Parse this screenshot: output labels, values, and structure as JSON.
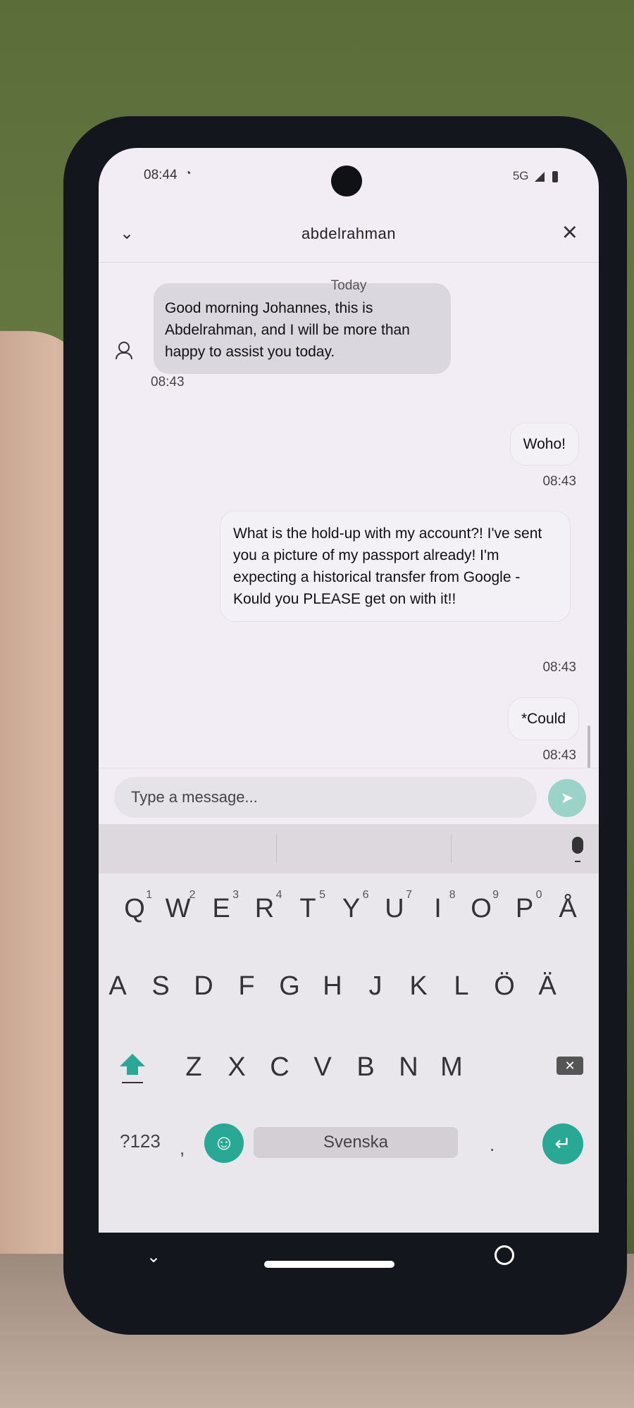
{
  "status_bar": {
    "time": "08:44",
    "network": "5G"
  },
  "header": {
    "title": "abdelrahman"
  },
  "chat": {
    "date_label": "Today",
    "messages": [
      {
        "direction": "in",
        "text": "Good morning Johannes, this is Abdelrahman, and I will be more than happy to assist you today.",
        "time": "08:43"
      },
      {
        "direction": "out",
        "text": "Woho!",
        "time": "08:43"
      },
      {
        "direction": "out",
        "text": "What is the hold-up with my account?! I've sent you a picture of my passport already! I'm expecting a historical transfer from Google - Kould you PLEASE get on with it!!",
        "time": "08:43"
      },
      {
        "direction": "out",
        "text": "*Could",
        "time": "08:43"
      }
    ]
  },
  "composer": {
    "placeholder": "Type a message..."
  },
  "keyboard": {
    "row1": [
      {
        "k": "Q",
        "h": "1"
      },
      {
        "k": "W",
        "h": "2"
      },
      {
        "k": "E",
        "h": "3"
      },
      {
        "k": "R",
        "h": "4"
      },
      {
        "k": "T",
        "h": "5"
      },
      {
        "k": "Y",
        "h": "6"
      },
      {
        "k": "U",
        "h": "7"
      },
      {
        "k": "I",
        "h": "8"
      },
      {
        "k": "O",
        "h": "9"
      },
      {
        "k": "P",
        "h": "0"
      },
      {
        "k": "Å",
        "h": ""
      }
    ],
    "row2": [
      "A",
      "S",
      "D",
      "F",
      "G",
      "H",
      "J",
      "K",
      "L",
      "Ö",
      "Ä"
    ],
    "row3": [
      "Z",
      "X",
      "C",
      "V",
      "B",
      "N",
      "M"
    ],
    "symbols_label": "?123",
    "comma": ",",
    "period": ".",
    "space_label": "Svenska"
  },
  "colors": {
    "accent": "#2aa896",
    "send_disabled": "#9bd3c8"
  }
}
